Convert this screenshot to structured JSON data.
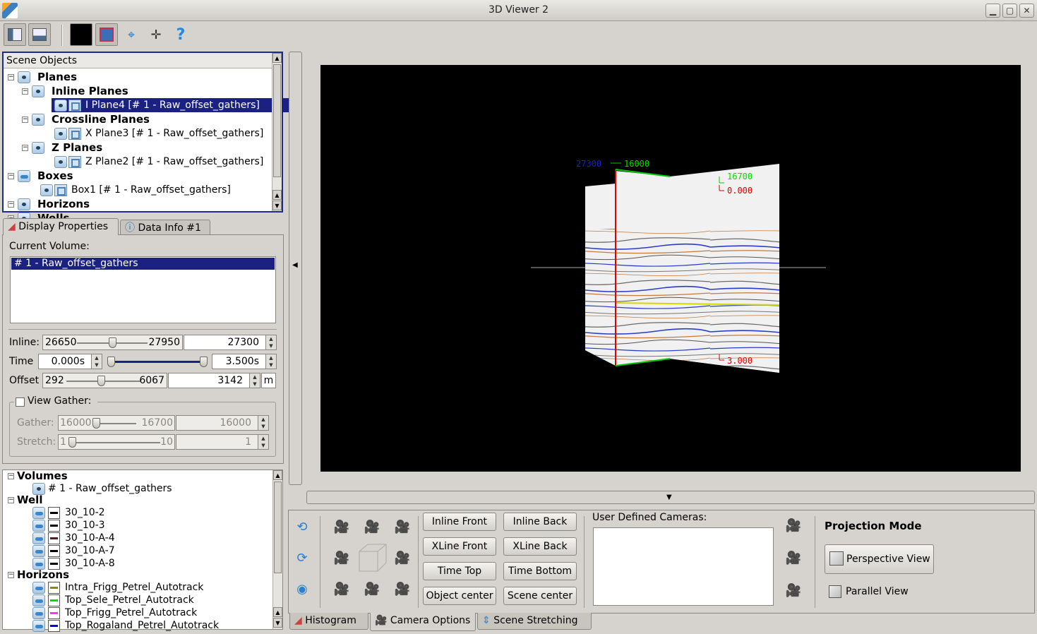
{
  "window": {
    "title": "3D Viewer 2",
    "minimize": "▁",
    "maximize": "▢",
    "close": "✕"
  },
  "toolbar": {
    "icons": [
      "layout-left-icon",
      "layout-bottom-icon",
      "background-color-icon",
      "cube-view-icon",
      "target-icon",
      "pick-point-icon",
      "help-icon"
    ],
    "help_glyph": "?"
  },
  "scene_tree": {
    "header": "Scene Objects",
    "items": [
      {
        "label": "Planes",
        "level": 0,
        "bold": true
      },
      {
        "label": "Inline Planes",
        "level": 1,
        "bold": true
      },
      {
        "label": "I Plane4 [# 1 - Raw_offset_gathers]",
        "level": 2,
        "selected": true
      },
      {
        "label": "Crossline Planes",
        "level": 1,
        "bold": true
      },
      {
        "label": "X Plane3 [# 1 - Raw_offset_gathers]",
        "level": 2
      },
      {
        "label": "Z Planes",
        "level": 1,
        "bold": true
      },
      {
        "label": "Z Plane2 [# 1 - Raw_offset_gathers]",
        "level": 2
      },
      {
        "label": "Boxes",
        "level": 0,
        "bold": true
      },
      {
        "label": "Box1 [# 1 - Raw_offset_gathers]",
        "level": 1
      },
      {
        "label": "Horizons",
        "level": 0,
        "bold": true
      },
      {
        "label": "Wells",
        "level": 0,
        "bold": true
      }
    ]
  },
  "props_tabs": {
    "display": "Display Properties",
    "data_info": "Data Info #1"
  },
  "display_props": {
    "current_volume_label": "Current Volume:",
    "volume_selected": "# 1 - Raw_offset_gathers",
    "inline": {
      "label": "Inline:",
      "min": "26650",
      "max": "27950",
      "value": "27300",
      "pos": 0.5
    },
    "time": {
      "label": "Time",
      "start": "0.000s",
      "end": "3.500s"
    },
    "offset": {
      "label": "Offset",
      "min": "292",
      "max": "6067",
      "value": "3142",
      "unit": "m",
      "pos": 0.5
    },
    "view_gather": {
      "label": "View Gather:",
      "gather": {
        "label": "Gather:",
        "min": "16000",
        "max": "16700",
        "value": "16000"
      },
      "stretch": {
        "label": "Stretch:",
        "min": "1",
        "max": "10",
        "value": "1"
      }
    }
  },
  "data_tree": {
    "volumes_label": "Volumes",
    "volume_item": "# 1 - Raw_offset_gathers",
    "well_label": "Well",
    "wells": [
      "30_10-2",
      "30_10-3",
      "30_10-A-4",
      "30_10-A-7",
      "30_10-A-8"
    ],
    "well_colors": [
      "#000000",
      "#000000",
      "#5a1a1a",
      "#000000",
      "#000000"
    ],
    "horizons_label": "Horizons",
    "horizons": [
      "Intra_Frigg_Petrel_Autotrack",
      "Top_Sele_Petrel_Autotrack",
      "Top_Frigg_Petrel_Autotrack",
      "Top_Rogaland_Petrel_Autotrack"
    ],
    "horizon_colors": [
      "#8a8a00",
      "#00dd00",
      "#ff33ff",
      "#0000ff"
    ]
  },
  "viewport": {
    "labels": {
      "inline_tag": "27300",
      "crossline_tag": "16000",
      "crossline_end_tag": "16700",
      "time_top": "0.000",
      "time_bottom": "3.000"
    },
    "colors": {
      "inline": "#0000cc",
      "crossline": "#00cc00",
      "time": "#cc0000",
      "background": "#000000"
    }
  },
  "camera_panel": {
    "view_buttons": [
      "Inline Front",
      "Inline Back",
      "XLine Front",
      "XLine Back",
      "Time Top",
      "Time Bottom",
      "Object center",
      "Scene center"
    ],
    "user_cameras_label": "User Defined Cameras:",
    "projection_label": "Projection Mode",
    "perspective": "Perspective View",
    "parallel": "Parallel View"
  },
  "bottom_tabs": {
    "histogram": "Histogram",
    "camera": "Camera Options",
    "stretching": "Scene Stretching"
  }
}
